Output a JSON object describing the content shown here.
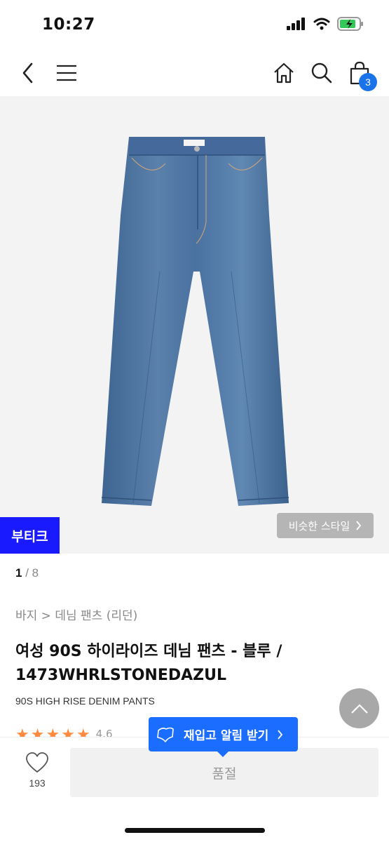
{
  "status_bar": {
    "time": "10:27"
  },
  "cart": {
    "count": "3"
  },
  "product_image": {
    "boutique_badge": "부티크",
    "similar_style_label": "비슷한 스타일"
  },
  "pager": {
    "current": "1",
    "separator": " / ",
    "total": "8"
  },
  "breadcrumb": "바지 > 데님 팬츠 (리던)",
  "product": {
    "title": "여성 90S 하이라이즈 데님 팬츠 - 블루 / 1473WHRLSTONEDAZUL",
    "subtitle": "90S HIGH RISE DENIM PANTS",
    "rating_label": "4.6",
    "rating_stars": [
      "★",
      "★",
      "★",
      "★",
      "★"
    ]
  },
  "restock": {
    "label": "재입고 알림 받기"
  },
  "bottom_bar": {
    "wish_count": "193",
    "soldout_label": "품절"
  },
  "colors": {
    "accent": "#1a6dff",
    "boutique": "#1a1aff",
    "star": "#ff8a3d",
    "badge": "#1a73e8"
  },
  "icons": [
    "back-icon",
    "menu-icon",
    "home-icon",
    "search-icon",
    "cart-icon",
    "heart-icon",
    "chevron-up-icon",
    "bell-icon",
    "chevron-right-icon"
  ]
}
